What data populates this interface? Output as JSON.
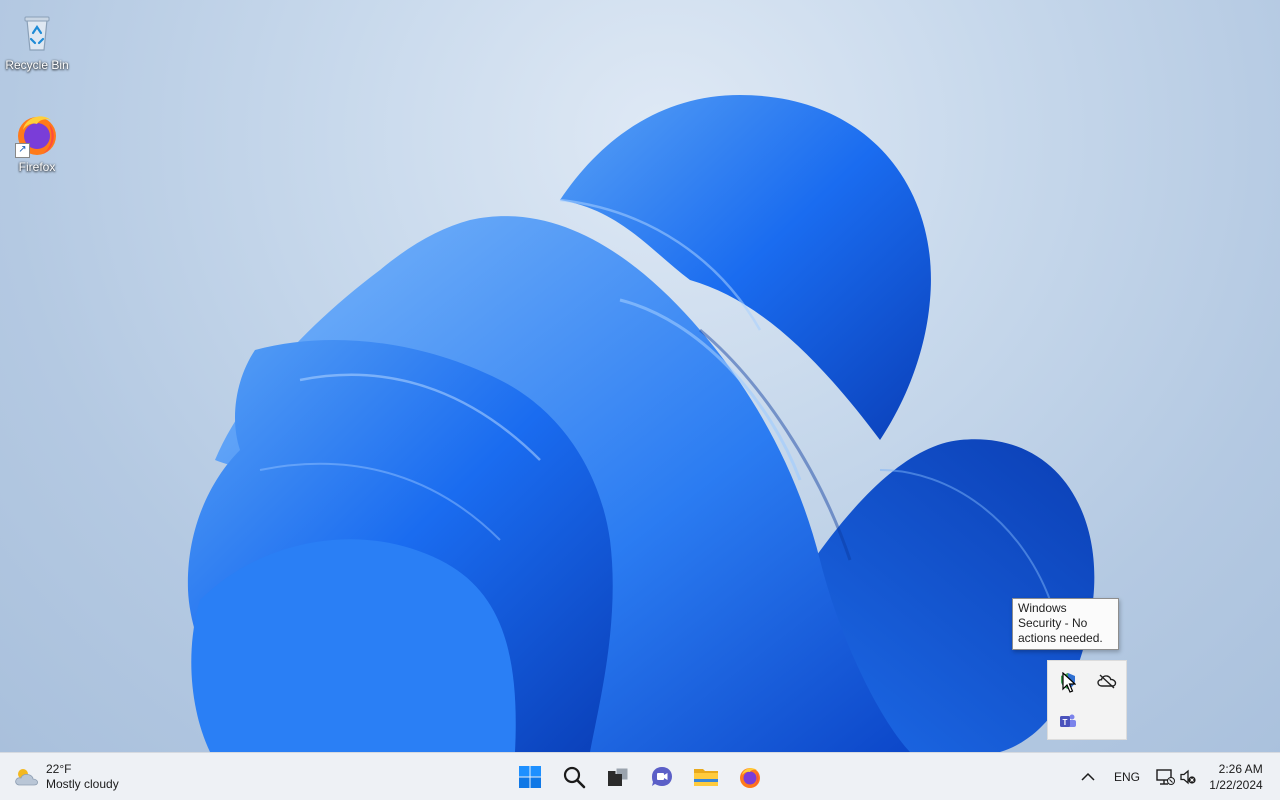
{
  "desktop": {
    "icons": [
      {
        "label": "Recycle Bin",
        "icon": "recycle-bin-icon"
      },
      {
        "label": "Firefox",
        "icon": "firefox-icon"
      }
    ]
  },
  "tooltip": {
    "text": "Windows Security - No actions needed."
  },
  "tray_overflow": {
    "items": [
      {
        "icon": "windows-security-icon"
      },
      {
        "icon": "onedrive-offline-icon"
      },
      {
        "icon": "teams-icon"
      }
    ]
  },
  "taskbar": {
    "weather": {
      "temp": "22°F",
      "condition": "Mostly cloudy",
      "icon": "cloudy-weather-icon"
    },
    "apps": [
      {
        "name": "start",
        "icon": "windows-start-icon"
      },
      {
        "name": "search",
        "icon": "search-icon"
      },
      {
        "name": "task-view",
        "icon": "task-view-icon"
      },
      {
        "name": "chat",
        "icon": "teams-chat-icon"
      },
      {
        "name": "file-explorer",
        "icon": "file-explorer-icon"
      },
      {
        "name": "firefox",
        "icon": "firefox-icon"
      }
    ],
    "tray": {
      "chevron_icon": "chevron-up-icon",
      "language": "ENG",
      "network_icon": "network-disconnected-icon",
      "volume_icon": "volume-muted-icon",
      "time": "2:26 AM",
      "date": "1/22/2024"
    }
  },
  "colors": {
    "accent": "#0a62d8",
    "taskbar_bg": "#eef1f5",
    "wallpaper_bg": "#c8d9ec"
  }
}
